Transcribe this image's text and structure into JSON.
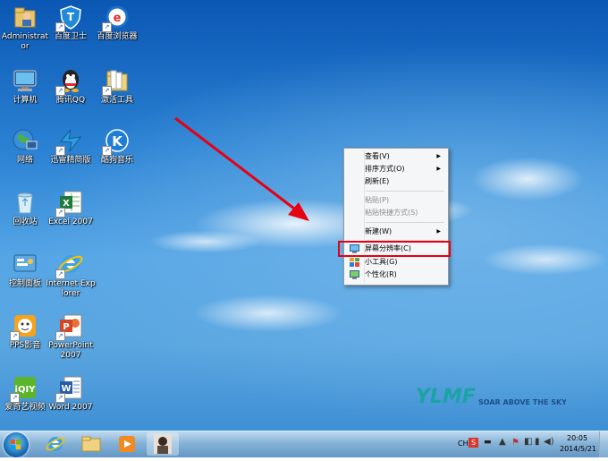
{
  "desktop_icons": [
    {
      "label": "Administrator",
      "icon": "user-folder-icon"
    },
    {
      "label": "百度卫士",
      "icon": "baidu-guard-icon"
    },
    {
      "label": "百度浏览器",
      "icon": "baidu-browser-icon"
    },
    {
      "label": "计算机",
      "icon": "computer-icon"
    },
    {
      "label": "腾讯QQ",
      "icon": "qq-icon"
    },
    {
      "label": "激活工具",
      "icon": "folder-icon"
    },
    {
      "label": "网络",
      "icon": "network-icon"
    },
    {
      "label": "迅雷精简版",
      "icon": "xunlei-icon"
    },
    {
      "label": "酷狗音乐",
      "icon": "kugou-icon"
    },
    {
      "label": "回收站",
      "icon": "recycle-bin-icon"
    },
    {
      "label": "Excel 2007",
      "icon": "excel-icon"
    },
    {
      "label": "控制面板",
      "icon": "control-panel-icon"
    },
    {
      "label": "Internet Explorer",
      "icon": "ie-icon"
    },
    {
      "label": "PPS影音",
      "icon": "pps-icon"
    },
    {
      "label": "PowerPoint 2007",
      "icon": "powerpoint-icon"
    },
    {
      "label": "爱奇艺视频",
      "icon": "iqiyi-icon"
    },
    {
      "label": "Word 2007",
      "icon": "word-icon"
    }
  ],
  "context_menu": {
    "view": "查看(V)",
    "sort": "排序方式(O)",
    "refresh": "刷新(E)",
    "paste": "粘贴(P)",
    "paste_shortcut": "粘贴快捷方式(S)",
    "new": "新建(W)",
    "resolution": "屏幕分辨率(C)",
    "gadgets": "小工具(G)",
    "personalize": "个性化(R)"
  },
  "wallpaper": {
    "logo_text": "YLMF",
    "slogan": "SOAR ABOVE THE SKY"
  },
  "taskbar": {
    "lang": "CH",
    "time": "20:05",
    "date": "2014/5/21"
  },
  "colors": {
    "highlight_box": "#e60012",
    "arrow": "#e60012"
  }
}
